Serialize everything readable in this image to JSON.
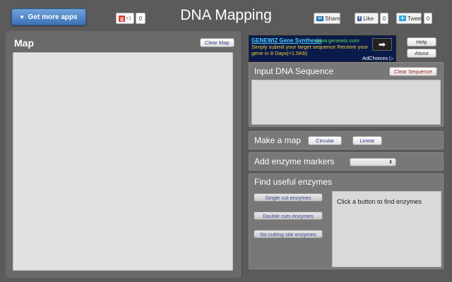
{
  "header": {
    "get_apps_label": "Get more apps",
    "heart_icon": "♥",
    "gplus_label": "+1",
    "gplus_count": "0",
    "title": "DNA Mapping",
    "linkedin_logo": "in",
    "linkedin_label": "Share",
    "facebook_logo": "f",
    "facebook_label": "Like",
    "facebook_count": "0",
    "twitter_label": "Tweet",
    "twitter_count": "0"
  },
  "map": {
    "title": "Map",
    "clear_label": "Clear Map"
  },
  "ad": {
    "title": "GENEWIZ Gene Synthesis",
    "url": "www.genewiz.com",
    "text": "Simply submit your target sequence Receive your gene in 8 Days(<1.5Kb)",
    "arrow": "➡",
    "choices": "AdChoices ▷"
  },
  "side_buttons": {
    "help": "Help",
    "about": "About"
  },
  "input_section": {
    "title": "Input DNA Sequence",
    "clear_label": "Clear Sequence"
  },
  "make_map": {
    "title": "Make a map",
    "circular_label": "Circular",
    "linear_label": "Linear"
  },
  "enzyme_markers": {
    "title": "Add enzyme markers",
    "select_arrow": "⬍",
    "selected_value": ""
  },
  "find_enzymes": {
    "title": "Find useful enzymes",
    "single_label": "Single cut enzymes",
    "double_label": "Double cuts enzymes",
    "none_label": "No cutting site enzymes",
    "result_text": "Click a button to find enzymes"
  }
}
